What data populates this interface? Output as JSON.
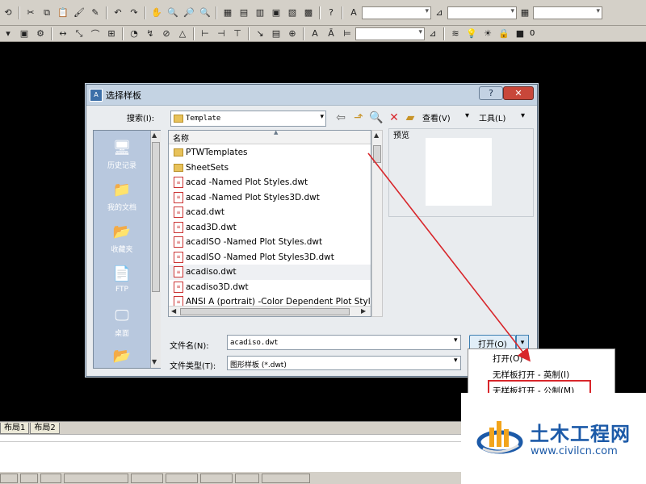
{
  "toolbar2": {
    "layer_value": "0"
  },
  "dialog": {
    "title": "选择样板",
    "app_icon": "A",
    "help": "?",
    "close": "✕",
    "search_label": "搜索(I):",
    "search_value": "Template",
    "view_menu": "查看(V)",
    "tools_menu": "工具(L)",
    "preview_label": "预览",
    "column_name": "名称",
    "files": [
      {
        "name": "PTWTemplates",
        "type": "folder"
      },
      {
        "name": "SheetSets",
        "type": "folder"
      },
      {
        "name": "acad -Named Plot Styles.dwt",
        "type": "dwt"
      },
      {
        "name": "acad -Named Plot Styles3D.dwt",
        "type": "dwt"
      },
      {
        "name": "acad.dwt",
        "type": "dwt"
      },
      {
        "name": "acad3D.dwt",
        "type": "dwt"
      },
      {
        "name": "acadISO -Named Plot Styles.dwt",
        "type": "dwt"
      },
      {
        "name": "acadISO -Named Plot Styles3D.dwt",
        "type": "dwt"
      },
      {
        "name": "acadiso.dwt",
        "type": "dwt",
        "selected": true
      },
      {
        "name": "acadiso3D.dwt",
        "type": "dwt"
      },
      {
        "name": "ANSI A (portrait) -Color Dependent Plot Styles.dwt",
        "type": "dwt"
      }
    ],
    "places": [
      {
        "label": "历史记录",
        "icon": "history-icon"
      },
      {
        "label": "我的文档",
        "icon": "documents-icon"
      },
      {
        "label": "收藏夹",
        "icon": "favorites-icon"
      },
      {
        "label": "FTP",
        "icon": "ftp-icon"
      },
      {
        "label": "桌面",
        "icon": "desktop-icon"
      }
    ],
    "filename_label": "文件名(N):",
    "filename_value": "acadiso.dwt",
    "filetype_label": "文件类型(T):",
    "filetype_value": "图形样板 (*.dwt)",
    "open_button": "打开(O)",
    "open_menu": [
      {
        "label": "打开(O)"
      },
      {
        "label": "无样板打开 - 英制(I)"
      },
      {
        "label": "无样板打开 - 公制(M)",
        "highlighted": true
      }
    ]
  },
  "layout_tabs": [
    "布局1",
    "布局2"
  ],
  "watermark": {
    "name": "土木工程网",
    "url": "www.civilcn.com"
  },
  "colors": {
    "accent": "#d8262b",
    "brand": "#1c5aa8"
  }
}
